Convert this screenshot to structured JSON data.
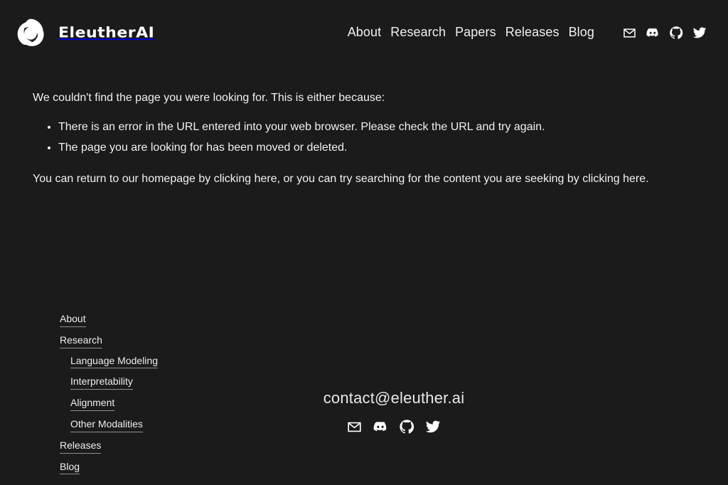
{
  "site": {
    "background_color": "#1b1b1b",
    "text_color": "#f1f1f1",
    "brand_name": "EleutherAI",
    "logo_icon": "eleuther-trefoil-logo"
  },
  "header": {
    "nav_items": [
      {
        "label": "About"
      },
      {
        "label": "Research"
      },
      {
        "label": "Papers"
      },
      {
        "label": "Releases"
      },
      {
        "label": "Blog"
      }
    ],
    "social_icons": [
      {
        "name": "mail-icon",
        "title": "Email"
      },
      {
        "name": "discord-icon",
        "title": "Discord"
      },
      {
        "name": "github-icon",
        "title": "GitHub"
      },
      {
        "name": "twitter-icon",
        "title": "Twitter"
      }
    ]
  },
  "main": {
    "lead": "We couldn't find the page you were looking for. This is either because:",
    "reasons": [
      "There is an error in the URL entered into your web browser. Please check the URL and try again.",
      "The page you are looking for has been moved or deleted."
    ],
    "closing": {
      "part1": "You can return to our homepage by clicking ",
      "link1": "here",
      "part2": ", or you can try searching for the content you are seeking by clicking ",
      "link2": "here",
      "part3": "."
    }
  },
  "footer": {
    "nav": [
      {
        "label": "About"
      },
      {
        "label": "Research"
      },
      {
        "label": "Releases"
      },
      {
        "label": "Blog"
      }
    ],
    "research_sub": [
      {
        "label": "Language Modeling"
      },
      {
        "label": "Interpretability"
      },
      {
        "label": "Alignment"
      },
      {
        "label": "Other Modalities"
      }
    ],
    "email": "contact@eleuther.ai",
    "social_icons": [
      {
        "name": "mail-icon",
        "title": "Email"
      },
      {
        "name": "discord-icon",
        "title": "Discord"
      },
      {
        "name": "github-icon",
        "title": "GitHub"
      },
      {
        "name": "twitter-icon",
        "title": "Twitter"
      }
    ]
  }
}
